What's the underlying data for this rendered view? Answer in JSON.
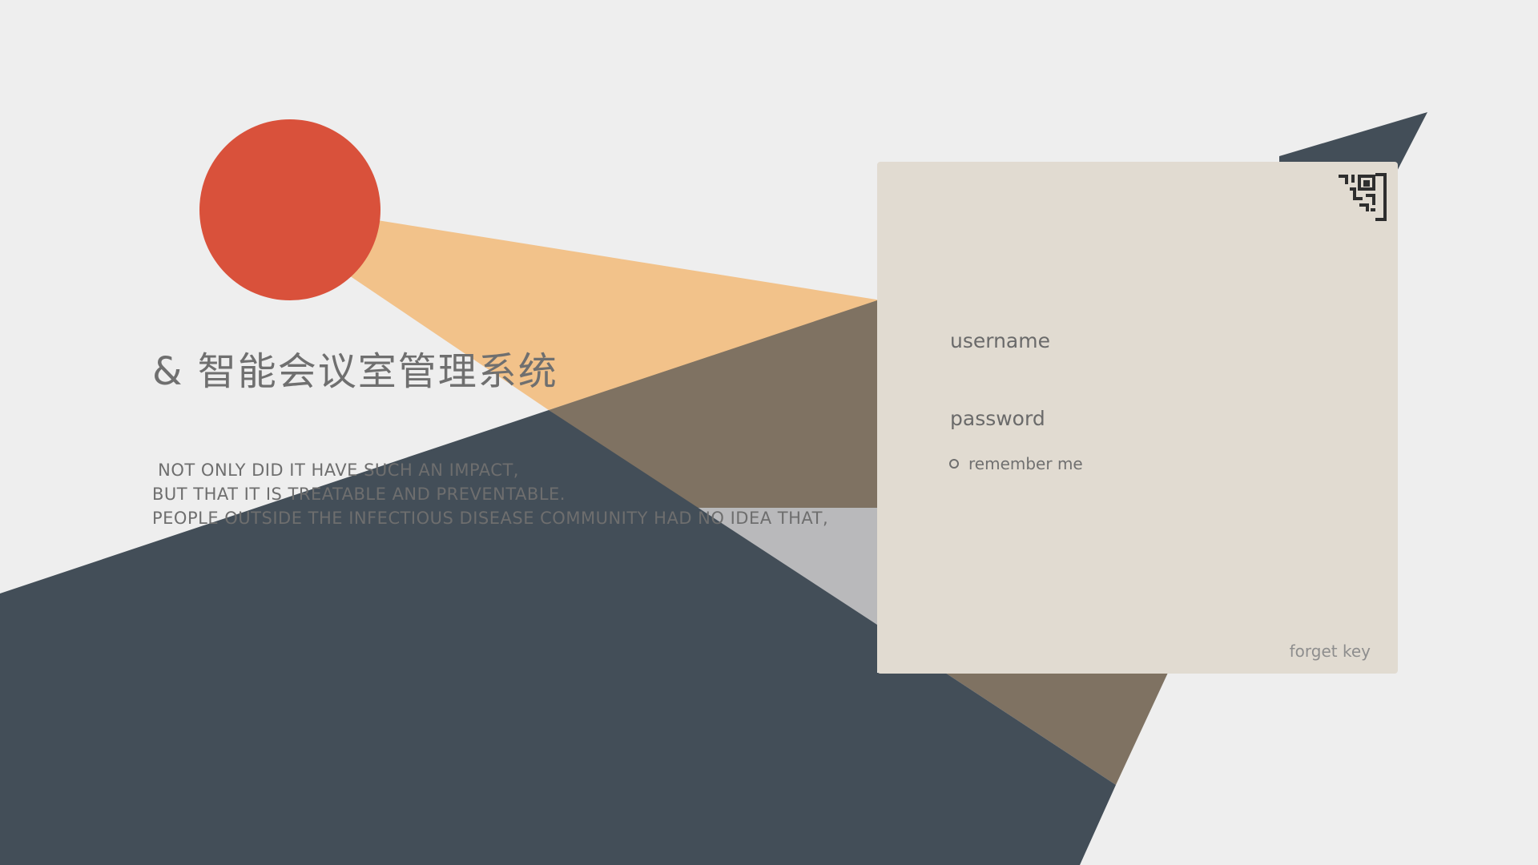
{
  "header": {
    "title": "& 智能会议室管理系统"
  },
  "tagline": {
    "lines": [
      " NOT ONLY DID IT HAVE SUCH AN IMPACT,",
      "BUT THAT IT IS TREATABLE AND PREVENTABLE.",
      "PEOPLE OUTSIDE THE INFECTIOUS DISEASE COMMUNITY HAD NO IDEA THAT,"
    ]
  },
  "login": {
    "username_placeholder": "username",
    "password_placeholder": "password",
    "remember_label": "remember me",
    "forget_label": "forget key",
    "qr_icon": "qr-code-icon"
  },
  "colors": {
    "background": "#eeeeee",
    "sun": "#d9513b",
    "beam": "#f2c28a",
    "mountain_dark": "#434e58",
    "mountain_brown": "#7f7262",
    "mountain_gray": "#b9b9bb",
    "card": "#e1dbd1"
  }
}
